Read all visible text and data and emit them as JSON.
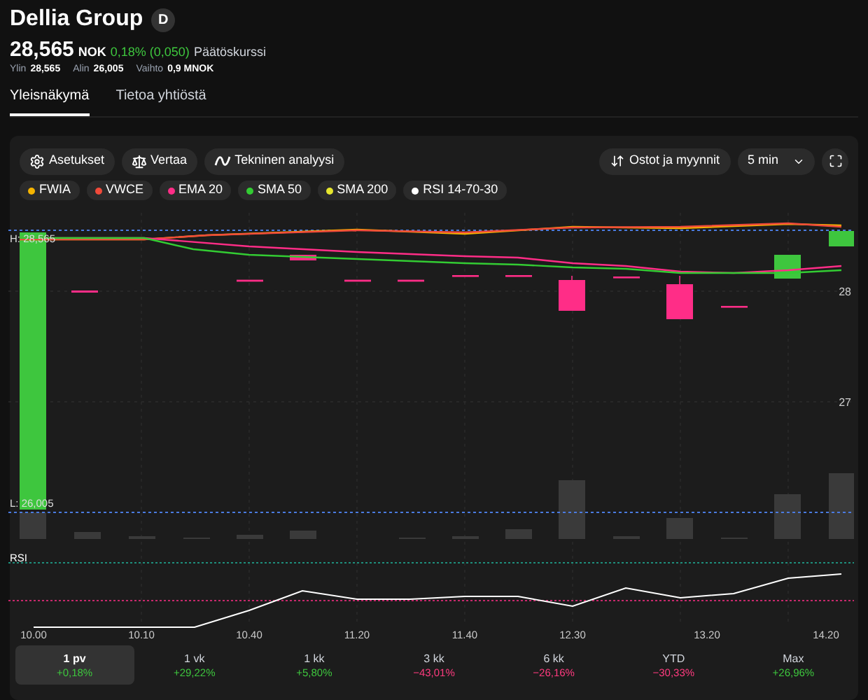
{
  "header": {
    "title": "Dellia Group",
    "badge": "D",
    "price": "28,565",
    "currency": "NOK",
    "change": "0,18% (0,050)",
    "color": "#3ec63e",
    "price_note": "Päätöskurssi",
    "stats": [
      {
        "label": "Ylin",
        "value": "28,565"
      },
      {
        "label": "Alin",
        "value": "26,005"
      },
      {
        "label": "Vaihto",
        "value": "0,9 MNOK"
      }
    ]
  },
  "tabs": [
    {
      "label": "Yleisnäkymä",
      "selected": true
    },
    {
      "label": "Tietoa yhtiöstä",
      "selected": false
    }
  ],
  "toolbar": {
    "left": [
      {
        "label": "Asetukset"
      },
      {
        "label": "Vertaa"
      },
      {
        "label": "Tekninen analyysi"
      }
    ],
    "trades": "Ostot ja myynnit",
    "interval": "5 min"
  },
  "legend": [
    {
      "label": "FWIA",
      "color": "#f5b400"
    },
    {
      "label": "VWCE",
      "color": "#f04a3a"
    },
    {
      "label": "EMA 20",
      "color": "#ff2d87"
    },
    {
      "label": "SMA 50",
      "color": "#33cc33"
    },
    {
      "label": "SMA 200",
      "color": "#e6e62e"
    },
    {
      "label": "RSI 14-70-30",
      "color": "#ffffff"
    }
  ],
  "chart": {
    "high_label": "H: 28,565",
    "low_label": "L: 26,005",
    "y_ticks": [
      "28",
      "27"
    ],
    "rsi_label": "RSI",
    "x_labels": [
      "10.00",
      "10.10",
      "10.40",
      "11.20",
      "11.40",
      "12.30",
      "13.20",
      "14.20"
    ]
  },
  "periods": [
    {
      "label": "1 pv",
      "change": "+0,18%",
      "color": "#3ec63e",
      "selected": true
    },
    {
      "label": "1 vk",
      "change": "+29,22%",
      "color": "#3ec63e",
      "selected": false
    },
    {
      "label": "1 kk",
      "change": "+5,80%",
      "color": "#3ec63e",
      "selected": false
    },
    {
      "label": "3 kk",
      "change": "−43,01%",
      "color": "#ff3b7f",
      "selected": false
    },
    {
      "label": "6 kk",
      "change": "−26,16%",
      "color": "#ff3b7f",
      "selected": false
    },
    {
      "label": "YTD",
      "change": "−30,33%",
      "color": "#ff3b7f",
      "selected": false
    },
    {
      "label": "Max",
      "change": "+26,96%",
      "color": "#3ec63e",
      "selected": false
    }
  ]
}
